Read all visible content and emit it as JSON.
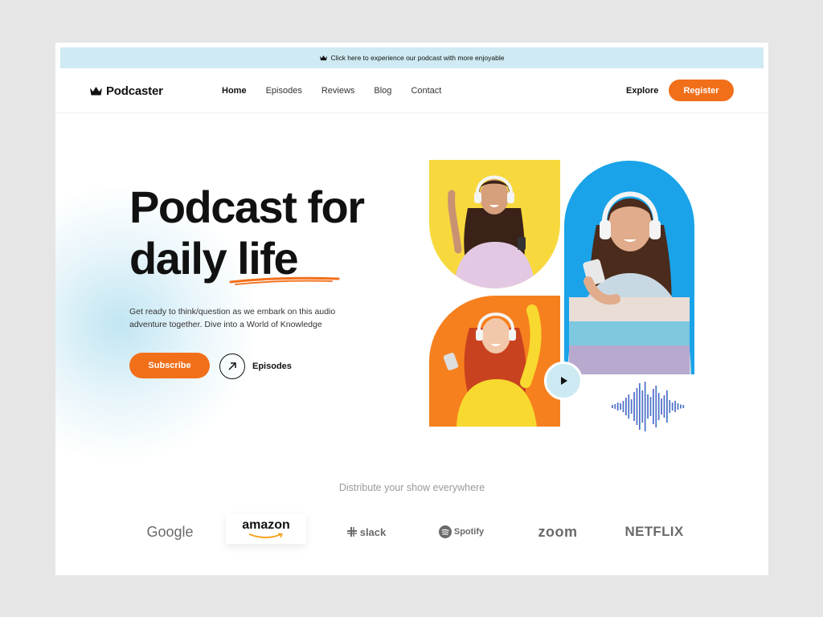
{
  "announcement": {
    "text": "Click here to experience our podcast with more enjoyable",
    "icon": "crown-icon"
  },
  "nav": {
    "logo": "Podcaster",
    "items": [
      {
        "label": "Home",
        "active": true
      },
      {
        "label": "Episodes",
        "active": false
      },
      {
        "label": "Reviews",
        "active": false
      },
      {
        "label": "Blog",
        "active": false
      },
      {
        "label": "Contact",
        "active": false
      }
    ],
    "explore": "Explore",
    "register": "Register"
  },
  "hero": {
    "line1": "Podcast for",
    "line2_a": "daily ",
    "line2_b": "life",
    "description": "Get ready to think/question as we embark on this audio adventure together.  Dive into a World of Knowledge",
    "subscribe": "Subscribe",
    "episodes": "Episodes"
  },
  "distribute": {
    "title": "Distribute your show everywhere",
    "brands": [
      "Google",
      "amazon",
      "slack",
      "Spotify",
      "zoom",
      "NETFLIX"
    ]
  },
  "colors": {
    "accent": "#f26f1a",
    "announce_bg": "#cfeaf3",
    "yellow": "#f7d93e",
    "orange": "#f7801e",
    "blue": "#1aa3e8"
  }
}
